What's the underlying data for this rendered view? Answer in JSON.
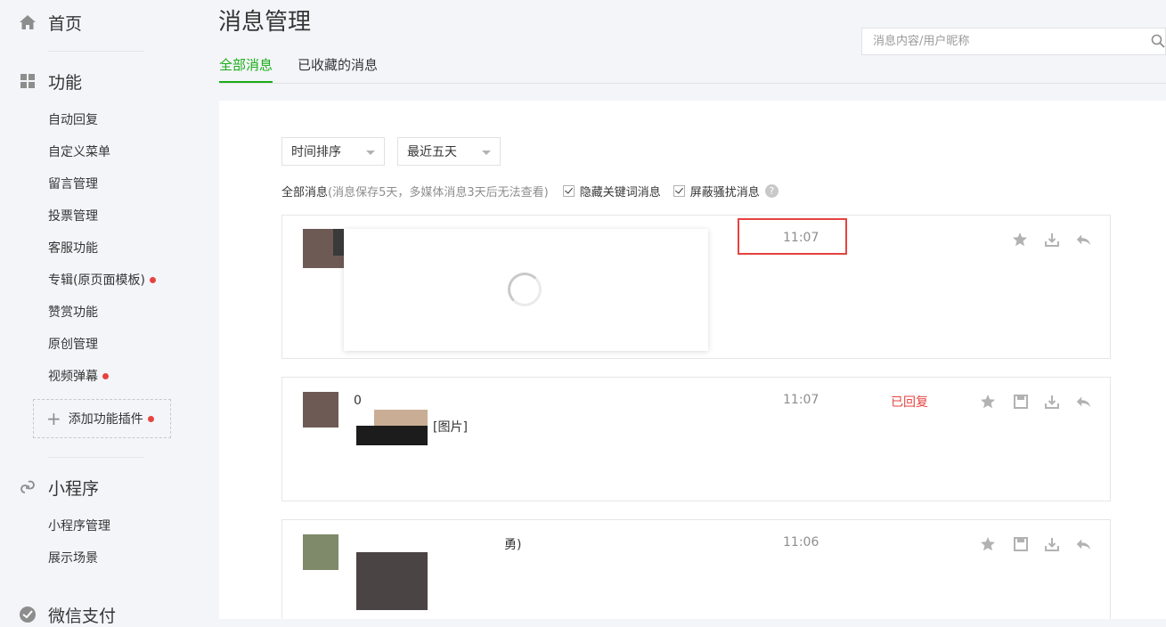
{
  "sidebar": {
    "home": "首页",
    "features": {
      "title": "功能",
      "items": [
        {
          "label": "自动回复",
          "dot": false
        },
        {
          "label": "自定义菜单",
          "dot": false
        },
        {
          "label": "留言管理",
          "dot": false
        },
        {
          "label": "投票管理",
          "dot": false
        },
        {
          "label": "客服功能",
          "dot": false
        },
        {
          "label": "专辑(原页面模板)",
          "dot": true
        },
        {
          "label": "赞赏功能",
          "dot": false
        },
        {
          "label": "原创管理",
          "dot": false
        },
        {
          "label": "视频弹幕",
          "dot": true
        }
      ],
      "add_plugin": "添加功能插件"
    },
    "miniprogram": {
      "title": "小程序",
      "items": [
        "小程序管理",
        "展示场景"
      ]
    },
    "wechat_pay": "微信支付"
  },
  "header": {
    "title": "消息管理",
    "tabs": [
      "全部消息",
      "已收藏的消息"
    ],
    "search_placeholder": "消息内容/用户昵称"
  },
  "toolbar": {
    "sort_select": "时间排序",
    "range_select": "最近五天",
    "filter_label": "全部消息",
    "filter_note": "(消息保存5天，多媒体消息3天后无法查看)",
    "hide_keyword": "隐藏关键词消息",
    "block_harass": "屏蔽骚扰消息",
    "help": "?"
  },
  "messages": [
    {
      "time": "11:07",
      "status": "",
      "text": ""
    },
    {
      "time": "11:07",
      "status": "已回复",
      "text": "[图片]",
      "nick_partial": "0"
    },
    {
      "time": "11:06",
      "status": "",
      "text": "勇)"
    }
  ],
  "colors": {
    "accent": "#1aad19",
    "alert": "#e64340"
  }
}
